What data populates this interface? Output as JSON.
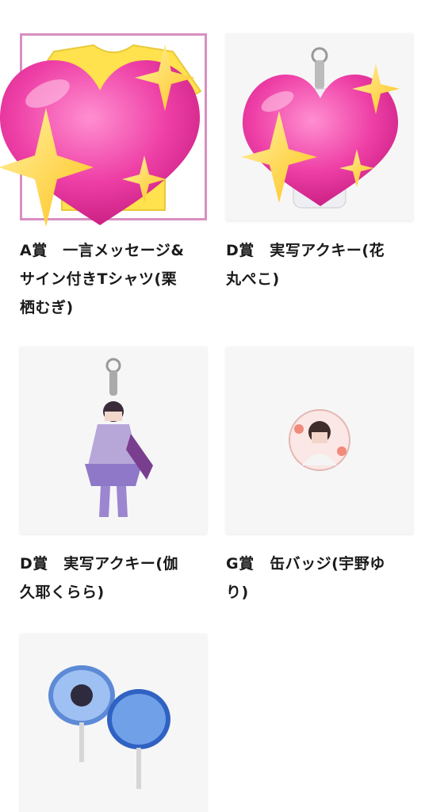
{
  "items": [
    {
      "title": "A賞　一言メッセージ&\nサイン付きTシャツ(栗\n栖むぎ)",
      "image": "tshirt-photo"
    },
    {
      "title": "D賞　実写アクキー(花\n丸ぺこ)",
      "image": "keychain-photo"
    },
    {
      "title": "D賞　実写アクキー(伽\n久耶くらら)",
      "image": "keychain-photo"
    },
    {
      "title": "G賞　缶バッジ(宇野ゆ\nり)",
      "image": "badge-photo"
    },
    {
      "title": "",
      "image": "fan-photo"
    }
  ],
  "stickers": [
    "sparkling-heart-icon",
    "sparkling-heart-icon"
  ],
  "colors": {
    "heart": "#ee3fa6",
    "sparkle": "#ffcc33",
    "tshirt": "#ffe24d"
  }
}
